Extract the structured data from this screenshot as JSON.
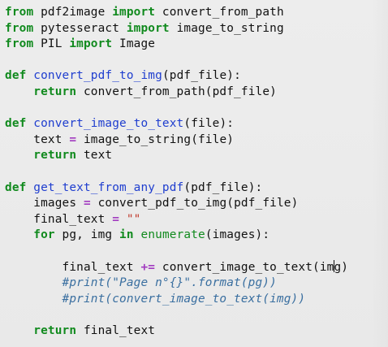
{
  "code": {
    "l1": {
      "kw1": "from",
      "mod": " pdf2image ",
      "kw2": "import",
      "name": " convert_from_path"
    },
    "l2": {
      "kw1": "from",
      "mod": " pytesseract ",
      "kw2": "import",
      "name": " image_to_string"
    },
    "l3": {
      "kw1": "from",
      "mod": " PIL ",
      "kw2": "import",
      "name": " Image"
    },
    "l5": {
      "kw": "def",
      "fn": "convert_pdf_to_img",
      "args": "(pdf_file):"
    },
    "l6": {
      "indent": "    ",
      "kw": "return",
      "rest": " convert_from_path(pdf_file)"
    },
    "l8": {
      "kw": "def",
      "fn": "convert_image_to_text",
      "args": "(file):"
    },
    "l9": {
      "indent": "    ",
      "var": "text ",
      "op": "=",
      "rest": " image_to_string(file)"
    },
    "l10": {
      "indent": "    ",
      "kw": "return",
      "rest": " text"
    },
    "l12": {
      "kw": "def",
      "fn": "get_text_from_any_pdf",
      "args": "(pdf_file):"
    },
    "l13": {
      "indent": "    ",
      "var": "images ",
      "op": "=",
      "rest": " convert_pdf_to_img(pdf_file)"
    },
    "l14": {
      "indent": "    ",
      "var": "final_text ",
      "op": "=",
      "str": " \"\""
    },
    "l15": {
      "indent": "    ",
      "kw": "for",
      "mid": " pg, img ",
      "kw2": "in",
      "builtin": " enumerate",
      "rest": "(images):"
    },
    "l17": {
      "indent": "        ",
      "var": "final_text ",
      "op": "+=",
      "rest": " convert_image_to_text(im",
      "rest2": "g)"
    },
    "l18": {
      "indent": "        ",
      "comment": "#print(\"Page n°{}\".format(pg))"
    },
    "l19": {
      "indent": "        ",
      "comment": "#print(convert_image_to_text(img))"
    },
    "l21": {
      "indent": "    ",
      "kw": "return",
      "rest": " final_text"
    }
  },
  "colors": {
    "keyword": "#118a1e",
    "function_name": "#1f3ecf",
    "operator": "#a23cc0",
    "string": "#c0392b",
    "comment": "#3a6fa0",
    "background": "#ebebeb"
  }
}
